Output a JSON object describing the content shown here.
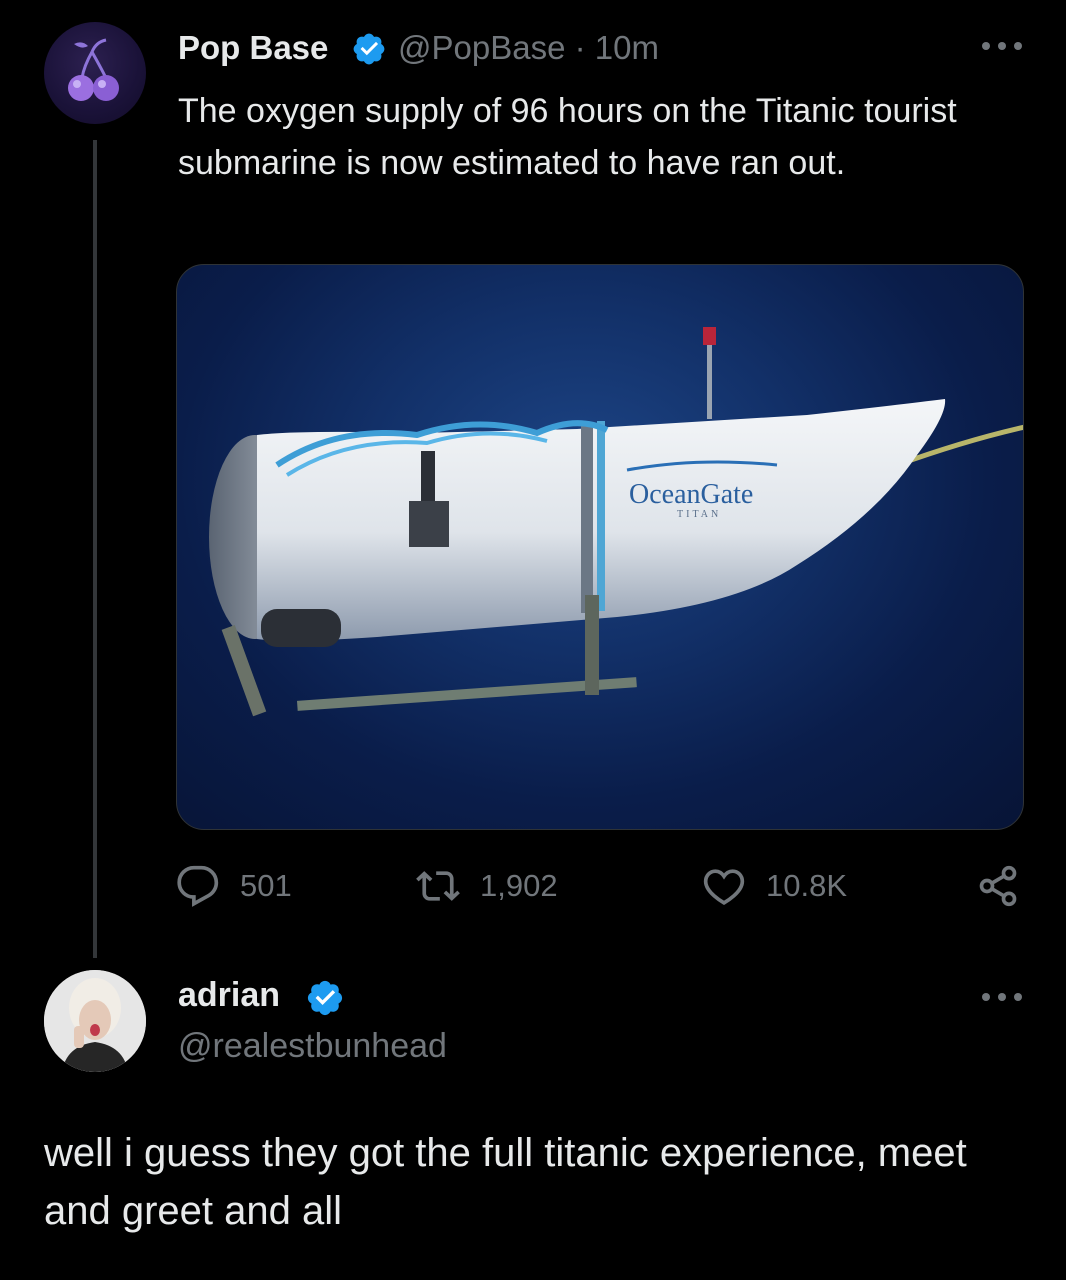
{
  "tweet": {
    "author_name": "Pop Base",
    "author_handle": "@PopBase",
    "separator": "·",
    "time": "10m",
    "text": "The oxygen supply of 96 hours on the Titanic tourist submarine is now estimated to have ran out.",
    "media": {
      "brand_text": "OceanGate",
      "sub_text": "TITAN"
    },
    "stats": {
      "replies": "501",
      "retweets": "1,902",
      "likes": "10.8K"
    }
  },
  "reply": {
    "author_name": "adrian",
    "author_handle": "@realestbunhead",
    "text": "well i guess they got the full titanic experience, meet and greet and all"
  },
  "icons": {
    "verified": "verified-badge-icon",
    "more": "more-options-icon",
    "reply": "reply-icon",
    "retweet": "retweet-icon",
    "like": "heart-icon",
    "share": "share-icon",
    "avatar1": "cherry-logo-icon"
  },
  "colors": {
    "background": "#000000",
    "text": "#e7e9ea",
    "muted": "#71767b",
    "verified": "#1d9bf0",
    "thread_line": "#333639"
  }
}
